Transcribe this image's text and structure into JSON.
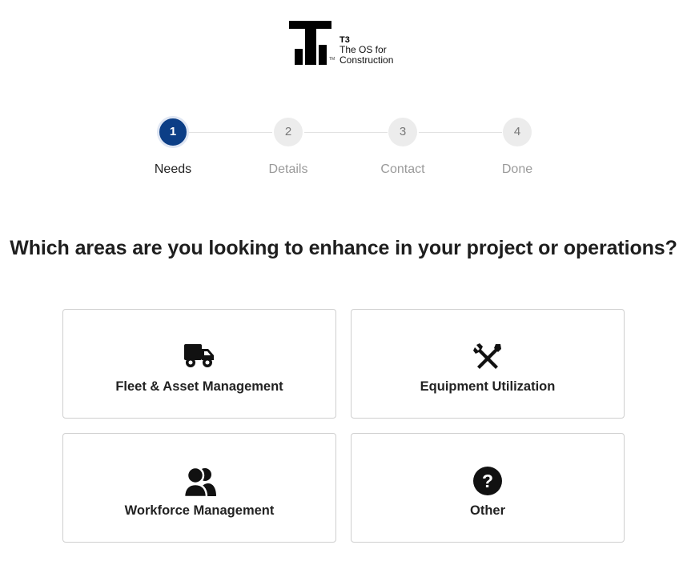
{
  "logo": {
    "brand": "T3",
    "tagline_line1": "The OS for",
    "tagline_line2": "Construction",
    "tm": "TM"
  },
  "stepper": {
    "steps": [
      {
        "number": "1",
        "label": "Needs",
        "active": true
      },
      {
        "number": "2",
        "label": "Details",
        "active": false
      },
      {
        "number": "3",
        "label": "Contact",
        "active": false
      },
      {
        "number": "4",
        "label": "Done",
        "active": false
      }
    ]
  },
  "question": "Which areas are you looking to enhance in your project or operations?",
  "options": [
    {
      "label": "Fleet & Asset Management",
      "icon": "truck-icon"
    },
    {
      "label": "Equipment Utilization",
      "icon": "tools-icon"
    },
    {
      "label": "Workforce Management",
      "icon": "people-icon"
    },
    {
      "label": "Other",
      "icon": "question-icon"
    }
  ],
  "colors": {
    "accent": "#0c3e86",
    "inactive_step": "#ececec",
    "border": "#cfcfcf"
  }
}
